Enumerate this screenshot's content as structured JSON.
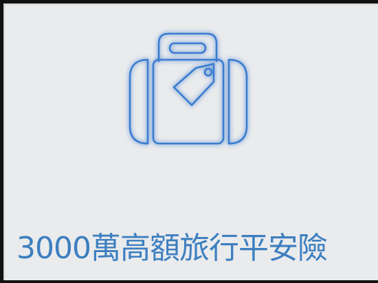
{
  "card": {
    "icon": "luggage-tag-icon",
    "title": "3000萬高額旅行平安險"
  },
  "colors": {
    "background": "#eaebed",
    "border": "#111111",
    "icon_stroke": "#3a7bcf",
    "icon_glow": "#7fb2f0",
    "title_text": "#3d7fc0"
  }
}
